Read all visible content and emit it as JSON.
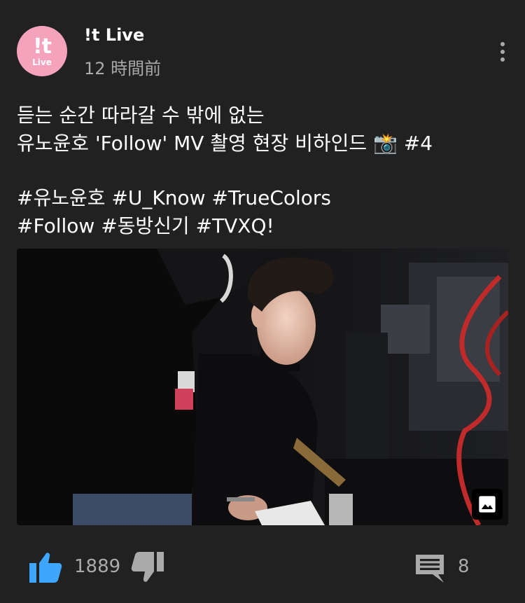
{
  "header": {
    "avatar_mark": "!t",
    "avatar_sub": "Live",
    "channel_name": "!t Live",
    "timestamp": "12 時間前"
  },
  "post": {
    "lines": [
      "듣는 순간 따라갈 수 밖에 없는",
      "유노윤호 'Follow' MV 촬영 현장 비하인드 📸 #4",
      "#유노윤호 #U_Know #TrueColors",
      "#Follow #동방신기 #TVXQ!"
    ]
  },
  "media": {
    "badge_icon": "image-icon"
  },
  "actions": {
    "like_icon": "thumbs-up-icon",
    "like_count": "1889",
    "dislike_icon": "thumbs-down-icon",
    "comment_icon": "comment-icon",
    "comment_count": "8"
  },
  "colors": {
    "background": "#212121",
    "accent_like": "#3ea6ff",
    "muted": "#aaaaaa",
    "avatar": "#f5a3bd"
  }
}
